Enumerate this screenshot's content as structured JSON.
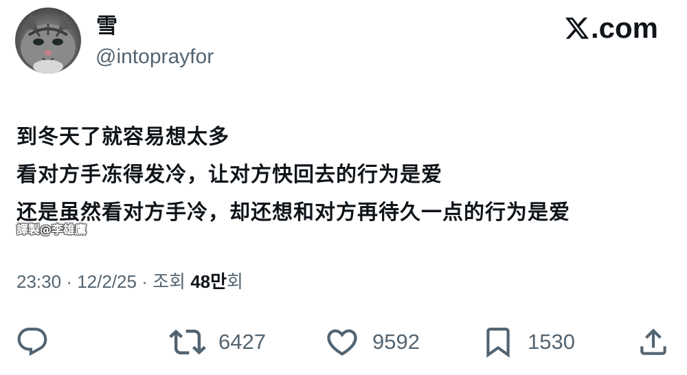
{
  "profile": {
    "display_name": "雪",
    "handle": "@intoprayfor"
  },
  "brand": {
    "text": ".com",
    "icon": "x-logo-icon"
  },
  "tweet": {
    "lines": [
      "到冬天了就容易想太多",
      "看对方手冻得发冷，让对方快回去的行为是爱",
      "还是虽然看对方手冷，却还想和对方再待久一点的行为是爱"
    ],
    "watermark": "譯製@李雄鷹"
  },
  "meta": {
    "time": "23:30",
    "separator": "·",
    "date": "12/2/25",
    "views_label": "조회",
    "views_number": "48",
    "views_unit": "만",
    "views_suffix": "회"
  },
  "actions": {
    "reply": {
      "icon": "reply-icon"
    },
    "retweet": {
      "icon": "retweet-icon",
      "count": "6427"
    },
    "like": {
      "icon": "heart-icon",
      "count": "9592"
    },
    "bookmark": {
      "icon": "bookmark-icon",
      "count": "1530"
    },
    "share": {
      "icon": "share-icon"
    }
  },
  "colors": {
    "text_primary": "#0f1419",
    "text_secondary": "#536471",
    "background": "#ffffff"
  }
}
